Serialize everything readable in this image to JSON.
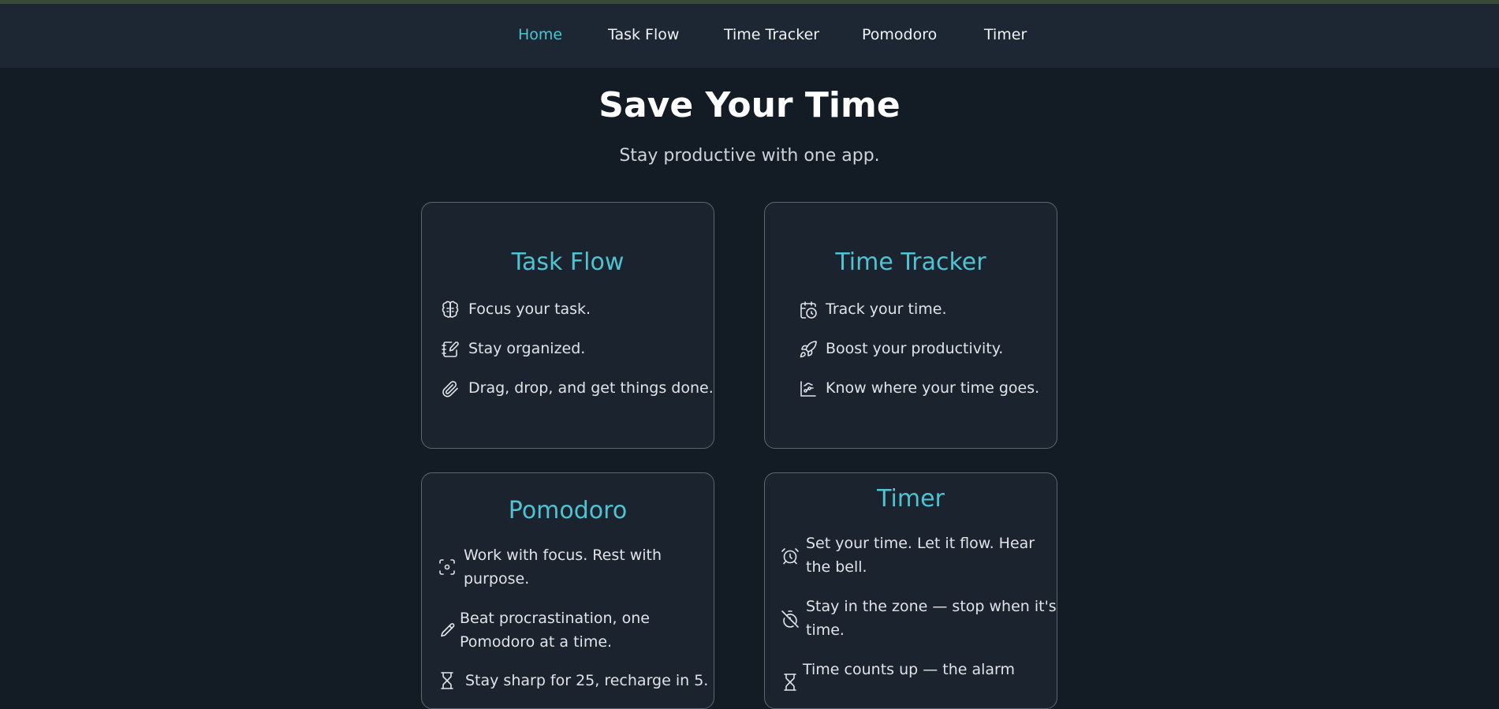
{
  "nav": {
    "items": [
      {
        "label": "Home",
        "active": true
      },
      {
        "label": "Task Flow"
      },
      {
        "label": "Time Tracker"
      },
      {
        "label": "Pomodoro"
      },
      {
        "label": "Timer"
      }
    ]
  },
  "hero": {
    "title": "Save Your Time",
    "subtitle": "Stay productive with one app."
  },
  "cards": [
    {
      "title": "Task Flow",
      "features": [
        {
          "icon": "brain-icon",
          "text": "Focus your task."
        },
        {
          "icon": "notebook-pen-icon",
          "text": "Stay organized."
        },
        {
          "icon": "paperclip-icon",
          "text": "Drag, drop, and get things done."
        }
      ]
    },
    {
      "title": "Time Tracker",
      "features": [
        {
          "icon": "calendar-clock-icon",
          "text": "Track your time."
        },
        {
          "icon": "rocket-icon",
          "text": "Boost your productivity."
        },
        {
          "icon": "chart-spline-icon",
          "text": "Know where your time goes."
        }
      ]
    },
    {
      "title": "Pomodoro",
      "features": [
        {
          "icon": "focus-scan-icon",
          "text": "Work with focus. Rest with"
        },
        {
          "icon": "focus-scan-icon",
          "text": "purpose."
        },
        {
          "icon": "pencil-icon",
          "text": "Beat procrastination, one"
        },
        {
          "icon": "pencil-icon",
          "text": "Pomodoro at a time."
        },
        {
          "icon": "hourglass-icon",
          "text": "Stay sharp for 25, recharge in 5."
        }
      ]
    },
    {
      "title": "Timer",
      "features": [
        {
          "icon": "alarm-clock-icon",
          "text": "Set your time. Let it flow. Hear"
        },
        {
          "icon": "alarm-clock-icon",
          "text": "the bell."
        },
        {
          "icon": "timer-off-icon",
          "text": "Stay in the zone — stop when it's"
        },
        {
          "icon": "timer-off-icon",
          "text": "time."
        },
        {
          "icon": "hourglass-icon",
          "text": "Time counts up — the alarm"
        }
      ]
    }
  ],
  "colors": {
    "accent": "#4fc3d1",
    "background": "#131c24",
    "navbar": "#1d2734",
    "card": "#1b232e"
  }
}
